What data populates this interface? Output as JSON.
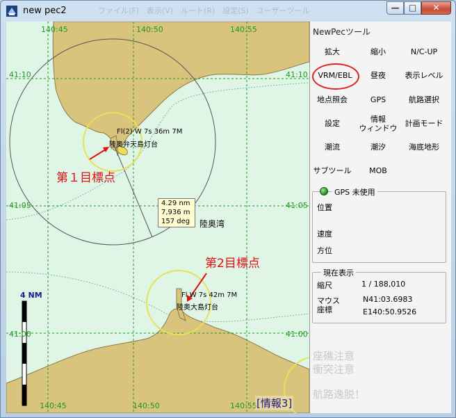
{
  "window": {
    "title": "new pec2",
    "ghost_tabs": "ファイル(F)　表示(V)　ルート(R)　設定(S)　ユーザーツール"
  },
  "controls": {
    "minimize": "—",
    "maximize": "□",
    "close": "✕"
  },
  "map": {
    "lon_labels": [
      "140:45",
      "140:50",
      "140:55"
    ],
    "lat_labels": [
      "41:10",
      "41:05",
      "41:00"
    ],
    "scale_label": "4  NM",
    "lighthouses": [
      {
        "char": "Fl(2) W 7s 36m 7M",
        "name": "陸奥弁天島灯台"
      },
      {
        "char": "Fl W 7s 42m 7M",
        "name": "陸奥大島灯台"
      }
    ],
    "bay_name": "陸奥湾",
    "readout": {
      "distance": "4.29 nm",
      "meters": "7,936 m",
      "bearing": "157 deg"
    },
    "annotations": {
      "target1": "第１目標点",
      "target2": "第2目標点"
    },
    "info_tag": "[情報3]"
  },
  "panel": {
    "title": "NewPecツール",
    "tools": [
      "拡大",
      "縮小",
      "N/C-UP",
      "VRM/EBL",
      "昼夜",
      "表示レベル",
      "地点照会",
      "GPS",
      "航路選択",
      "設定",
      "情報\nウィンドウ",
      "計画モード",
      "潮流",
      "潮汐",
      "海底地形",
      "サブツール",
      "MOB"
    ],
    "gps": {
      "legend": "GPS 未使用",
      "position": "位置",
      "speed": "速度",
      "heading": "方位"
    },
    "current": {
      "legend": "現在表示",
      "scale_label": "縮尺",
      "scale_value": "1 / 188,010",
      "coord_label_1": "マウス",
      "coord_label_2": "座標",
      "lat": "N41:03.6983",
      "lon": "E140:50.9526"
    },
    "warnings": {
      "shoal": "座礁注意",
      "collision": "衝突注意",
      "offcourse": "航路逸脱！"
    }
  },
  "colors": {
    "sea": "#dff5e6",
    "land": "#d9c47e",
    "grid": "#1a9a1a",
    "annotation": "#e01010",
    "vrm_ring": "#e8e05a"
  }
}
